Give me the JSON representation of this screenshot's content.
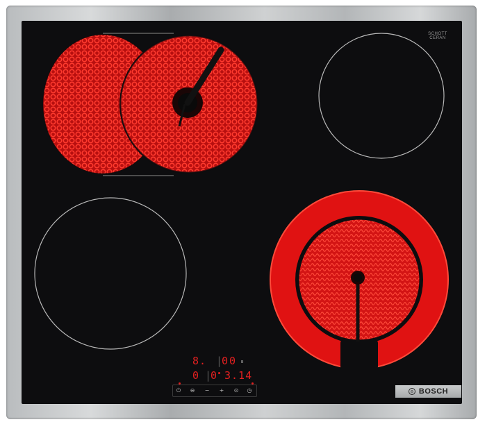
{
  "brand": {
    "name": "BOSCH",
    "logo_icon": "bosch-armature-icon"
  },
  "glass_maker": {
    "line1": "SCHOTT",
    "line2": "CERAN",
    "line3": ""
  },
  "model_label": "",
  "colors": {
    "frame": "#c3c5c7",
    "glass": "#0d0d0f",
    "heat": "#e01212",
    "display": "#e32020"
  },
  "display": {
    "row1_left": "8.",
    "row1_mid": "0",
    "row1_right": "0",
    "row1_aux": "B",
    "row2_left": "0",
    "row2_mid": "0",
    "row2_right": "3.14"
  },
  "controls": [
    {
      "name": "power",
      "symbol": "⏻"
    },
    {
      "name": "lock",
      "symbol": "⊖"
    },
    {
      "name": "minus",
      "symbol": "−"
    },
    {
      "name": "plus",
      "symbol": "+"
    },
    {
      "name": "timer",
      "symbol": "⊙"
    },
    {
      "name": "clock",
      "symbol": "◷"
    }
  ],
  "zones": [
    {
      "name": "rear-left-dual",
      "state": "heating"
    },
    {
      "name": "rear-right",
      "state": "off"
    },
    {
      "name": "front-left",
      "state": "off"
    },
    {
      "name": "front-right-dual",
      "state": "heating"
    }
  ]
}
